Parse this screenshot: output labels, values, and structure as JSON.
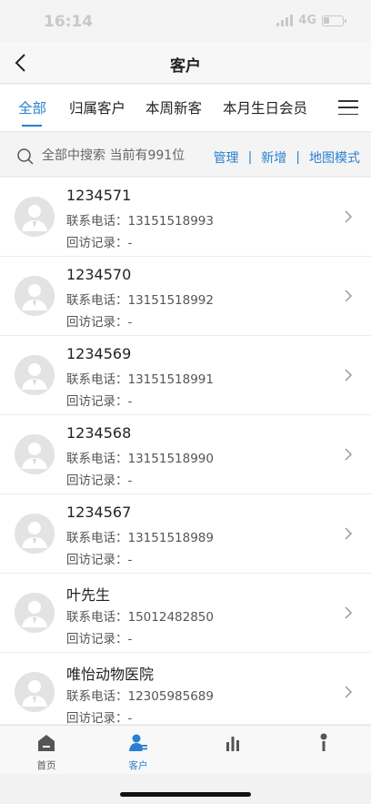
{
  "status": {
    "time": "16:14",
    "network": "4G",
    "battery_level": 0.3
  },
  "nav": {
    "title": "客户"
  },
  "tabs": [
    {
      "label": "全部",
      "active": true
    },
    {
      "label": "归属客户",
      "active": false
    },
    {
      "label": "本周新客",
      "active": false
    },
    {
      "label": "本月生日会员",
      "active": false
    }
  ],
  "search": {
    "placeholder": "全部中搜索 当前有991位"
  },
  "actions": {
    "manage": "管理",
    "add": "新增",
    "map": "地图模式",
    "separator": "|"
  },
  "customers": [
    {
      "name": "1234571",
      "phone": "联系电话：13151518993",
      "visit": "回访记录：-"
    },
    {
      "name": "1234570",
      "phone": "联系电话：13151518992",
      "visit": "回访记录：-"
    },
    {
      "name": "1234569",
      "phone": "联系电话：13151518991",
      "visit": "回访记录：-"
    },
    {
      "name": "1234568",
      "phone": "联系电话：13151518990",
      "visit": "回访记录：-"
    },
    {
      "name": "1234567",
      "phone": "联系电话：13151518989",
      "visit": "回访记录：-"
    },
    {
      "name": "叶先生",
      "phone": "联系电话：15012482850",
      "visit": "回访记录：-"
    },
    {
      "name": "唯怡动物医院",
      "phone": "联系电话：12305985689",
      "visit": "回访记录：-"
    }
  ],
  "bottom_tabs": [
    {
      "label": "首页",
      "icon": "home-icon",
      "active": false
    },
    {
      "label": "客户",
      "icon": "customer-icon",
      "active": true
    },
    {
      "label": "",
      "icon": "chart-icon",
      "active": false
    },
    {
      "label": "",
      "icon": "profile-icon",
      "active": false
    }
  ],
  "colors": {
    "accent": "#2a7fd0",
    "text": "#222222",
    "muted": "#555555"
  }
}
